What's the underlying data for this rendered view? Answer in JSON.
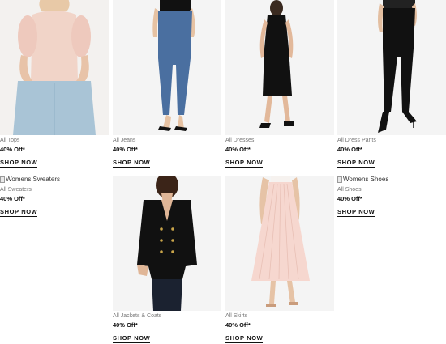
{
  "products": [
    {
      "category": "All Tops",
      "offer": "40% Off*",
      "cta": "SHOP NOW"
    },
    {
      "category": "All Jeans",
      "offer": "40% Off*",
      "cta": "SHOP NOW"
    },
    {
      "category": "All Dresses",
      "offer": "40% Off*",
      "cta": "SHOP NOW"
    },
    {
      "category": "All Dress Pants",
      "offer": "40% Off*",
      "cta": "SHOP NOW"
    },
    {
      "category": "All Sweaters",
      "offer": "40% Off*",
      "cta": "SHOP NOW",
      "image_alt": "Womens Sweaters"
    },
    {
      "category": "All Jackets & Coats",
      "offer": "40% Off*",
      "cta": "SHOP NOW"
    },
    {
      "category": "All Skirts",
      "offer": "40% Off*",
      "cta": "SHOP NOW"
    },
    {
      "category": "All Shoes",
      "offer": "40% Off*",
      "cta": "SHOP NOW",
      "image_alt": "Womens Shoes"
    }
  ],
  "colors": {
    "photo_bg": "#f4f4f4",
    "text_primary": "#111111",
    "text_muted": "#777777"
  }
}
